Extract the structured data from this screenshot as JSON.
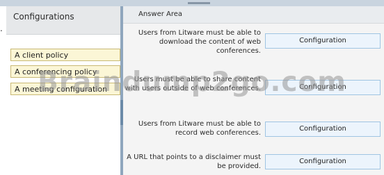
{
  "left": {
    "title": "Configurations",
    "options": [
      "A client policy",
      "A conferencing policy",
      "A meeting configuration"
    ]
  },
  "right": {
    "title": "Answer Area",
    "rows": [
      {
        "requirement": "Users from Litware must be able to download the content of web conferences.",
        "slot": "Configuration"
      },
      {
        "requirement": "Users must be able to share content with users outside of web conferences.",
        "slot": "Configuration"
      },
      {
        "requirement": "Users from Litware must be able to record web conferences.",
        "slot": "Configuration"
      },
      {
        "requirement": "A URL that points to a disclaimer must be provided.",
        "slot": "Configuration"
      }
    ]
  },
  "watermark": "Braindump2go.com",
  "colors": {
    "option_bg": "#fbf6d6",
    "target_bg": "#ecf4fc",
    "splitter": "#8fa6bd"
  }
}
